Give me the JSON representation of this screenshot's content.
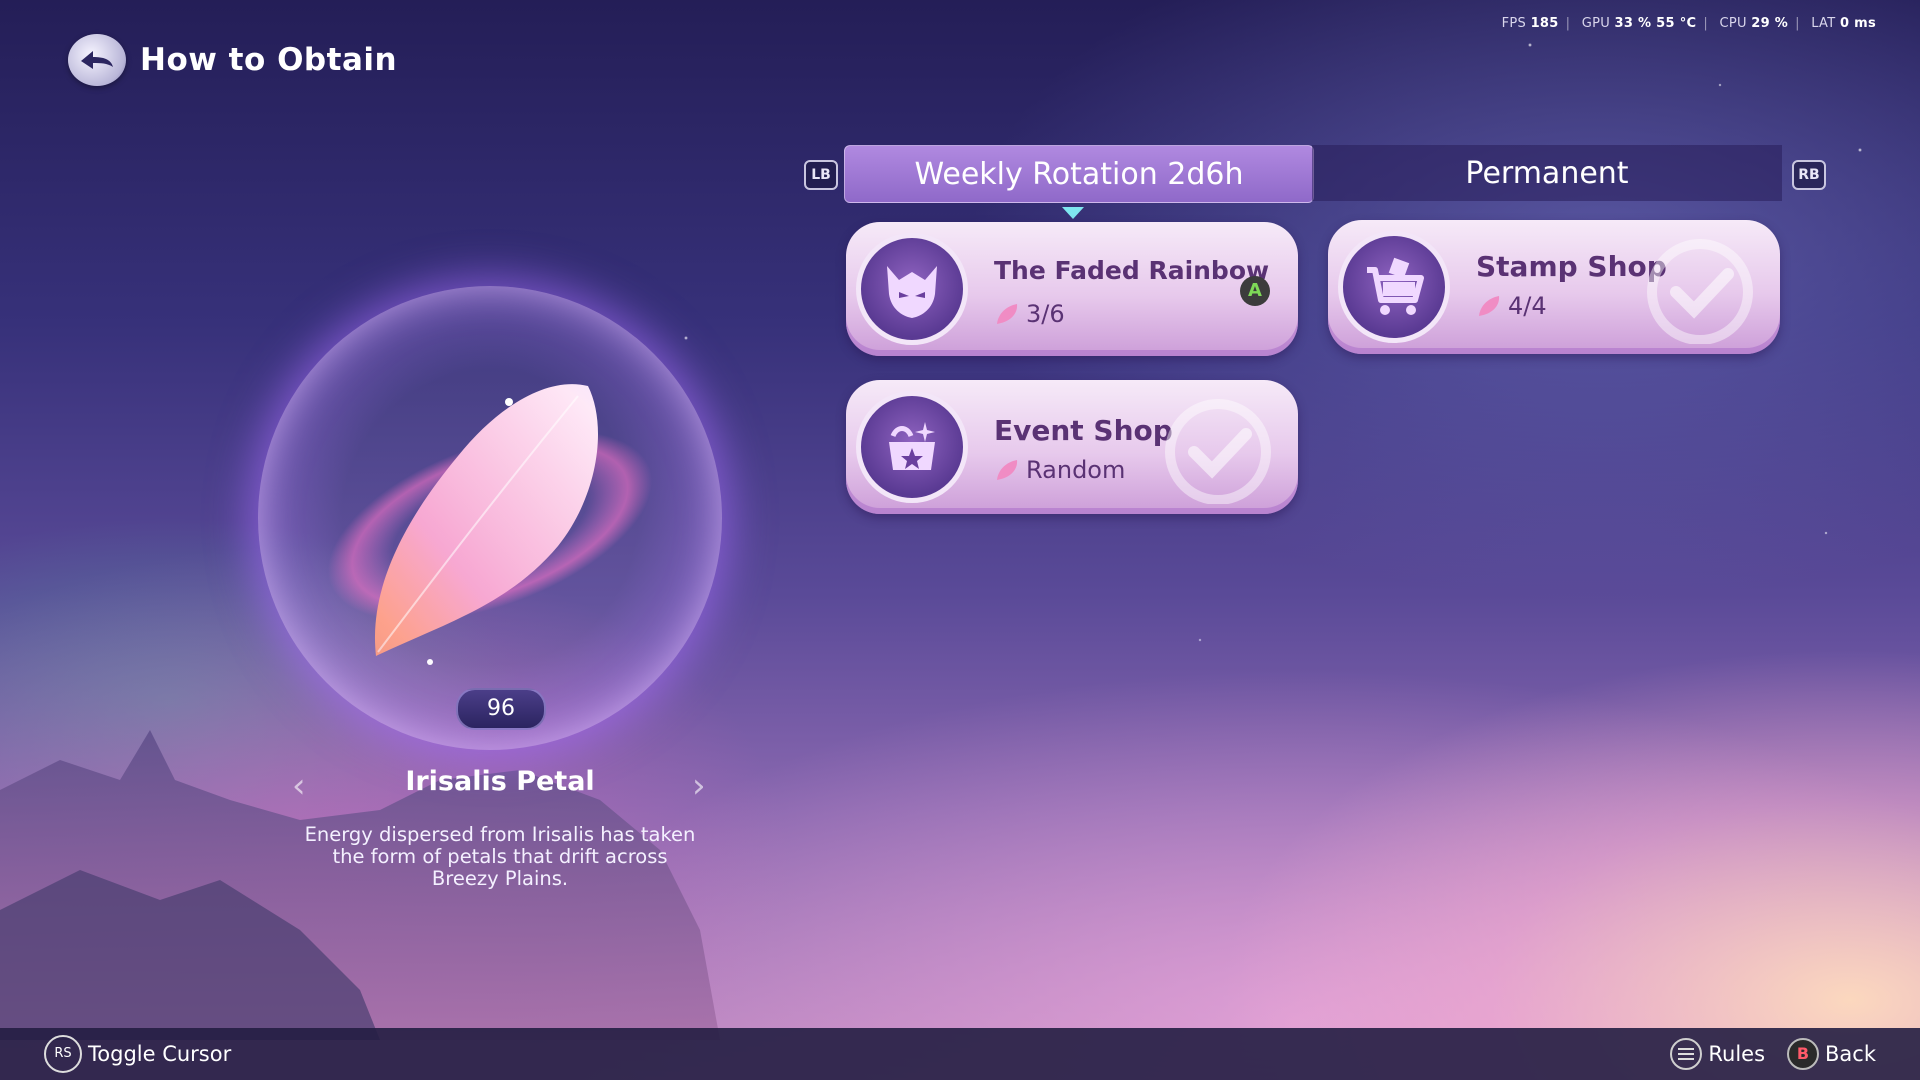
{
  "header": {
    "title": "How to Obtain"
  },
  "hud": {
    "fps_label": "FPS",
    "fps_value": "185",
    "gpu_label": "GPU",
    "gpu_value": "33 % 55 °C",
    "cpu_label": "CPU",
    "cpu_value": "29 %",
    "lat_label": "LAT",
    "lat_value": "0 ms"
  },
  "item": {
    "count": "96",
    "name": "Irisalis Petal",
    "description": "Energy dispersed from Irisalis has taken the form of petals that drift across Breezy Plains."
  },
  "tabs": {
    "lb_label": "LB",
    "rb_label": "RB",
    "items": [
      {
        "label": "Weekly Rotation 2d6h",
        "active": true
      },
      {
        "label": "Permanent",
        "active": false
      }
    ]
  },
  "sources": [
    {
      "name": "The Faded Rainbow",
      "progress": "3/6",
      "icon": "demon-mask-icon",
      "button": "A",
      "completed": false
    },
    {
      "name": "Stamp Shop",
      "progress": "4/4",
      "icon": "shopping-cart-icon",
      "completed": true
    },
    {
      "name": "Event Shop",
      "progress": "Random",
      "icon": "gift-basket-icon",
      "completed": true
    }
  ],
  "bottom_bar": {
    "rs_label": "RS",
    "toggle_cursor": "Toggle Cursor",
    "rules": "Rules",
    "b_label": "B",
    "back": "Back"
  },
  "colors": {
    "tab_active": "#9a74d2",
    "card_bg": "#e7c9ec",
    "emblem": "#6b46a6",
    "marker": "#7fe7f0"
  }
}
